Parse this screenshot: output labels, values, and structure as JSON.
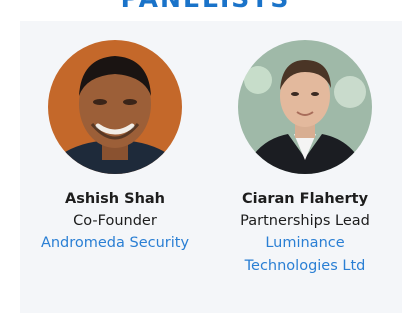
{
  "section": {
    "title": "PANELISTS"
  },
  "colors": {
    "accent": "#1a73c9",
    "link": "#2a7fd4",
    "panel_bg": "#f4f6f9"
  },
  "panelists": [
    {
      "name": "Ashish Shah",
      "role": "Co-Founder",
      "company": "Andromeda Security",
      "photo_icon": "headshot-photo"
    },
    {
      "name": "Ciaran Flaherty",
      "role": "Partnerships Lead",
      "company": "Luminance Technologies Ltd",
      "photo_icon": "headshot-photo"
    }
  ]
}
